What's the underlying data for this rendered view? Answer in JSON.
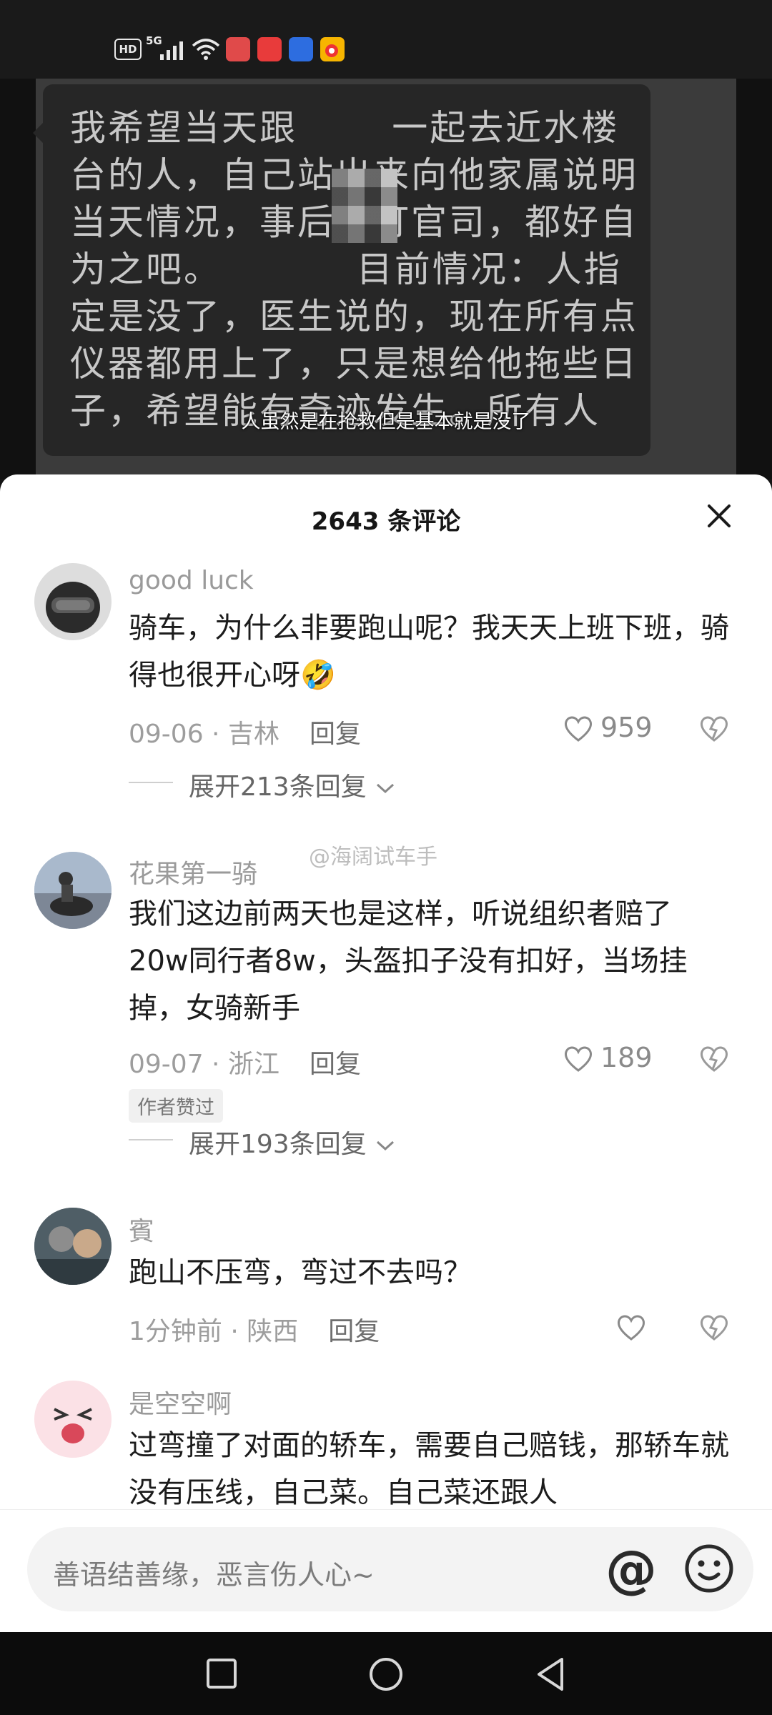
{
  "status_bar": {
    "hd": "HD",
    "network": "5G",
    "app_icons": [
      {
        "name": "book-app-icon",
        "color": "#e04a4a"
      },
      {
        "name": "huawei-mall-app-icon",
        "color": "#e83b3b"
      },
      {
        "name": "autohome-app-icon",
        "color": "#2d6de0"
      },
      {
        "name": "weibo-app-icon",
        "color": "#f7b500"
      }
    ]
  },
  "video": {
    "bubble_text": "我希望当天跟       一起去近水楼台的人，自己站出来向他家属说明当天情况，事后得打官司，都好自为之吧。          目前情况：人指定是没了，医生说的，现在所有点仪器都用上了，只是想给他拖些日子，希望能有奇迹发生。所有人",
    "subtitle": "人虽然是在抢救但是基本就是没了"
  },
  "sheet": {
    "title": "2643 条评论",
    "watermark": "@海阔试车手"
  },
  "comments": [
    {
      "username": "good luck",
      "text": "骑车，为什么非要跑山呢？我天天上班下班，骑得也很开心呀🤣",
      "date": "09-06",
      "location": "吉林",
      "reply_label": "回复",
      "likes": "959",
      "expand_label": "展开213条回复"
    },
    {
      "username": "花果第一骑",
      "text": "我们这边前两天也是这样，听说组织者赔了20w同行者8w，头盔扣子没有扣好，当场挂掉，女骑新手",
      "date": "09-07",
      "location": "浙江",
      "reply_label": "回复",
      "likes": "189",
      "badge": "作者赞过",
      "expand_label": "展开193条回复"
    },
    {
      "username": "賓",
      "text": "跑山不压弯，弯过不去吗？",
      "date": "1分钟前",
      "location": "陕西",
      "reply_label": "回复"
    },
    {
      "username": "是空空啊",
      "text": "过弯撞了对面的轿车，需要自己赔钱，那轿车就没有压线，自己菜。自己菜还跟人"
    }
  ],
  "input_bar": {
    "placeholder": "善语结善缘，恶言伤人心~"
  }
}
